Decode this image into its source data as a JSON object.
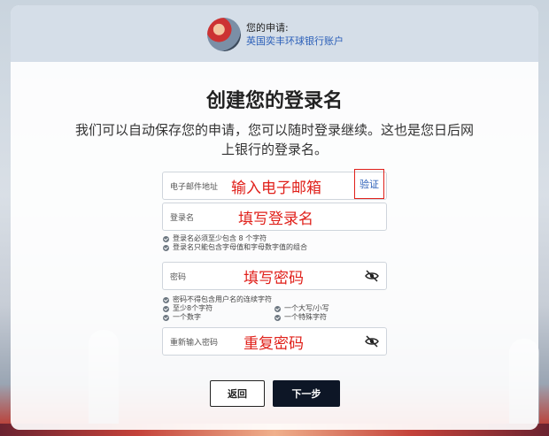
{
  "header": {
    "application_label": "您的申请:",
    "application_name": "英国奕丰环球银行账户"
  },
  "main": {
    "title": "创建您的登录名",
    "description": "我们可以自动保存您的申请，您可以随时登录继续。这也是您日后网上银行的登录名。"
  },
  "fields": {
    "email": {
      "label": "电子邮件地址",
      "annotation": "输入电子邮箱",
      "verify_label": "验证"
    },
    "username": {
      "label": "登录名",
      "annotation": "填写登录名"
    },
    "password": {
      "label": "密码",
      "annotation": "填写密码"
    },
    "confirm_password": {
      "label": "重新输入密码",
      "annotation": "重复密码"
    }
  },
  "username_rules": [
    "登录名必须至少包含 8 个字符",
    "登录名只能包含字母值和字母数字值的组合"
  ],
  "password_rules": {
    "full": "密码不得包含用户名的连续字符",
    "left": [
      "至少8个字符",
      "一个数字"
    ],
    "right": [
      "一个大写/小写",
      "一个特殊字符"
    ]
  },
  "buttons": {
    "back_label": "返回",
    "next_label": "下一步"
  },
  "colors": {
    "annotation": "#e0201a",
    "link": "#2b5fb8",
    "primary_button": "#0d1626"
  }
}
